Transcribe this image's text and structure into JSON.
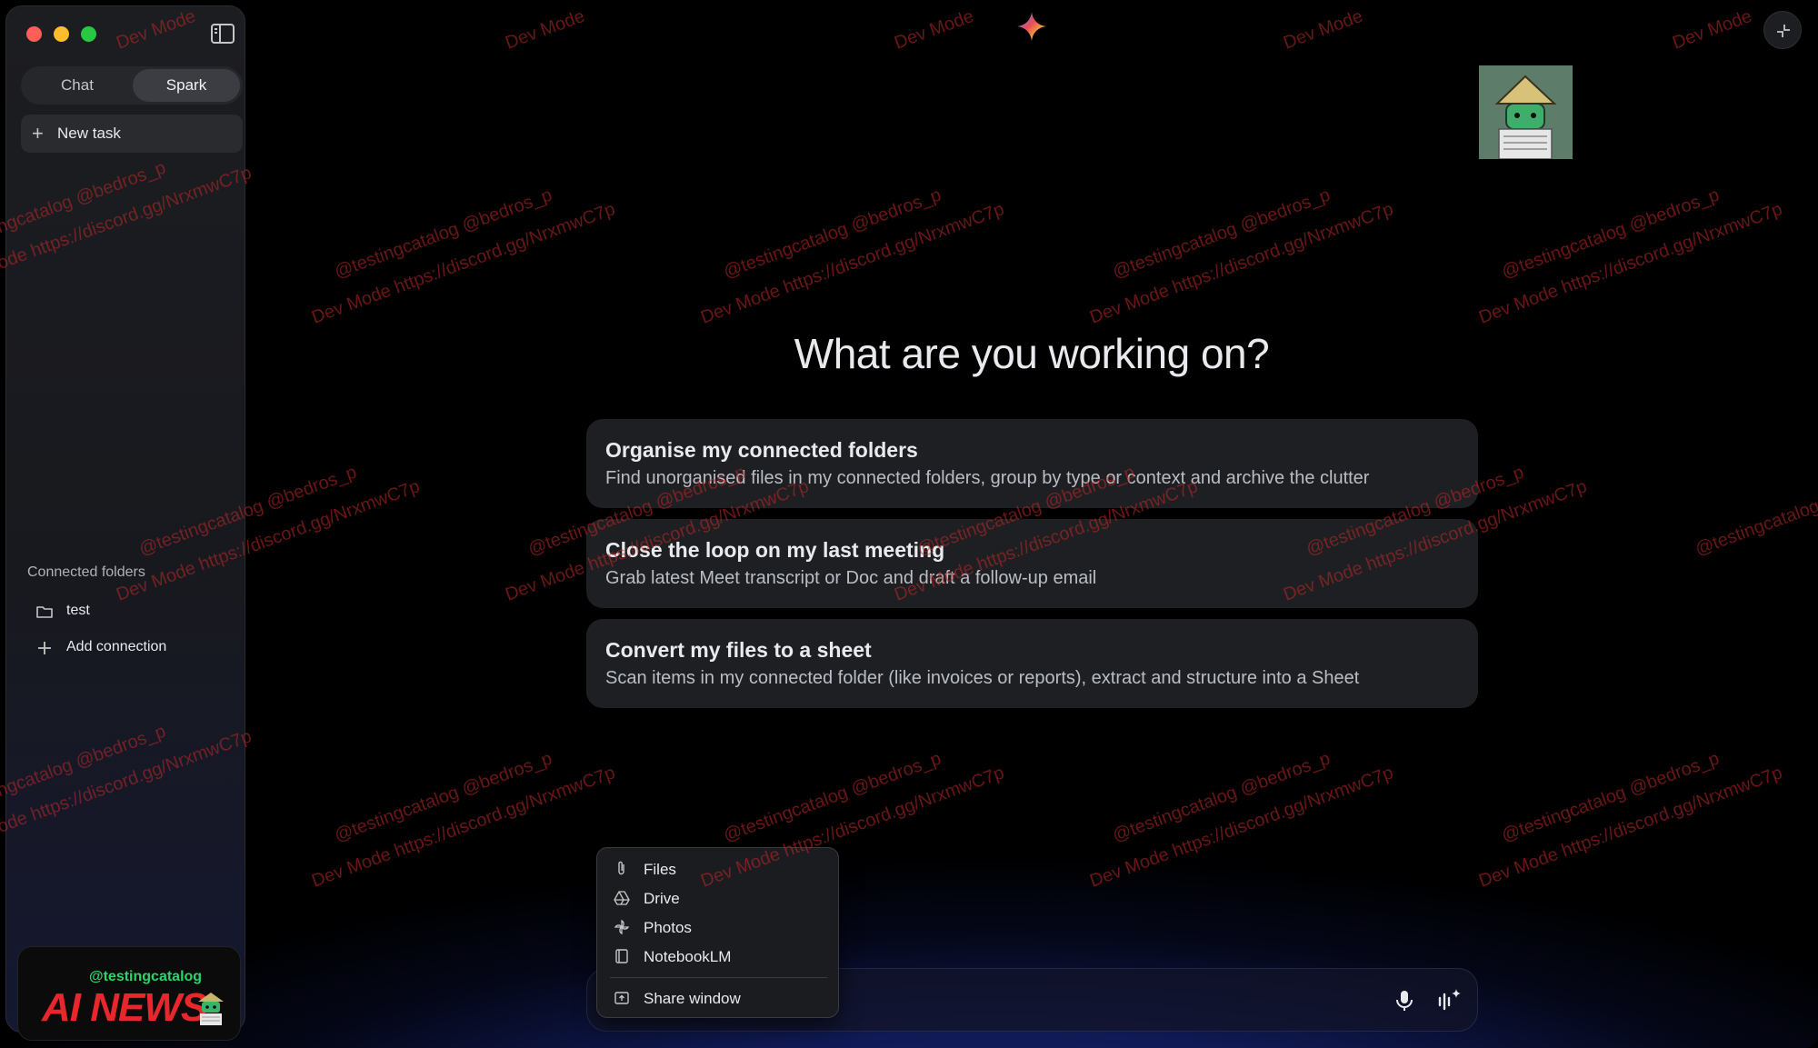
{
  "sidebar": {
    "tabs": [
      {
        "label": "Chat",
        "active": false
      },
      {
        "label": "Spark",
        "active": true
      }
    ],
    "new_task_label": "New task",
    "connected_folders_title": "Connected folders",
    "folders": [
      {
        "label": "test",
        "icon": "folder-icon"
      }
    ],
    "add_connection_label": "Add connection",
    "badge": {
      "handle": "@testingcatalog",
      "title": "AI NEWS"
    }
  },
  "main": {
    "heading": "What are you working on?",
    "suggestions": [
      {
        "title": "Organise my connected folders",
        "description": "Find unorganised files in my connected folders, group by type or context and archive the clutter"
      },
      {
        "title": "Close the loop on my last meeting",
        "description": "Grab latest Meet transcript or Doc and draft a follow-up email"
      },
      {
        "title": "Convert my files to a sheet",
        "description": "Scan items in my connected folder (like invoices or reports), extract and structure into a Sheet"
      }
    ]
  },
  "attach_menu": {
    "items": [
      {
        "label": "Files",
        "icon": "paperclip-icon"
      },
      {
        "label": "Drive",
        "icon": "drive-icon"
      },
      {
        "label": "Photos",
        "icon": "photos-icon"
      },
      {
        "label": "NotebookLM",
        "icon": "notebook-icon"
      },
      {
        "label": "Share window",
        "icon": "share-window-icon"
      }
    ]
  },
  "watermark": {
    "dev_mode": "Dev Mode",
    "line1": "@testingcatalog @bedros_p",
    "line2": "Dev Mode https://discord.gg/NrxmwC7p"
  },
  "colors": {
    "background": "#000000",
    "sidebar": "#1c1d21",
    "card": "#1e1f22",
    "accent_glow": "#1b2a7a",
    "watermark": "#be2828"
  }
}
